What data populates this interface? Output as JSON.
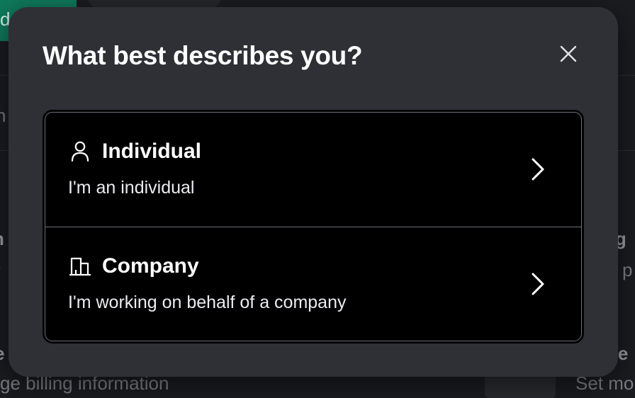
{
  "background": {
    "top_left_fragment": "d",
    "left_fragment_1": "h",
    "left_fragment_2": "n",
    "left_fragment_3": "r",
    "right_fragment_1": "ng",
    "right_fragment_2": "p",
    "bottom_left_fragment_bold": "e",
    "bottom_left_text": "ge billing information",
    "bottom_right_fragment_bold": "ge",
    "bottom_right_text": "Set mo"
  },
  "modal": {
    "title": "What best describes you?",
    "close_icon": "close-icon",
    "options": [
      {
        "icon": "person-icon",
        "title": "Individual",
        "description": "I'm an individual",
        "chevron_icon": "chevron-right-icon"
      },
      {
        "icon": "building-icon",
        "title": "Company",
        "description": "I'm working on behalf of a company",
        "chevron_icon": "chevron-right-icon"
      }
    ]
  },
  "colors": {
    "modal_background": "#2f3036",
    "options_background": "#000000",
    "text": "#ffffff",
    "accent_green": "#0f7a5c"
  }
}
